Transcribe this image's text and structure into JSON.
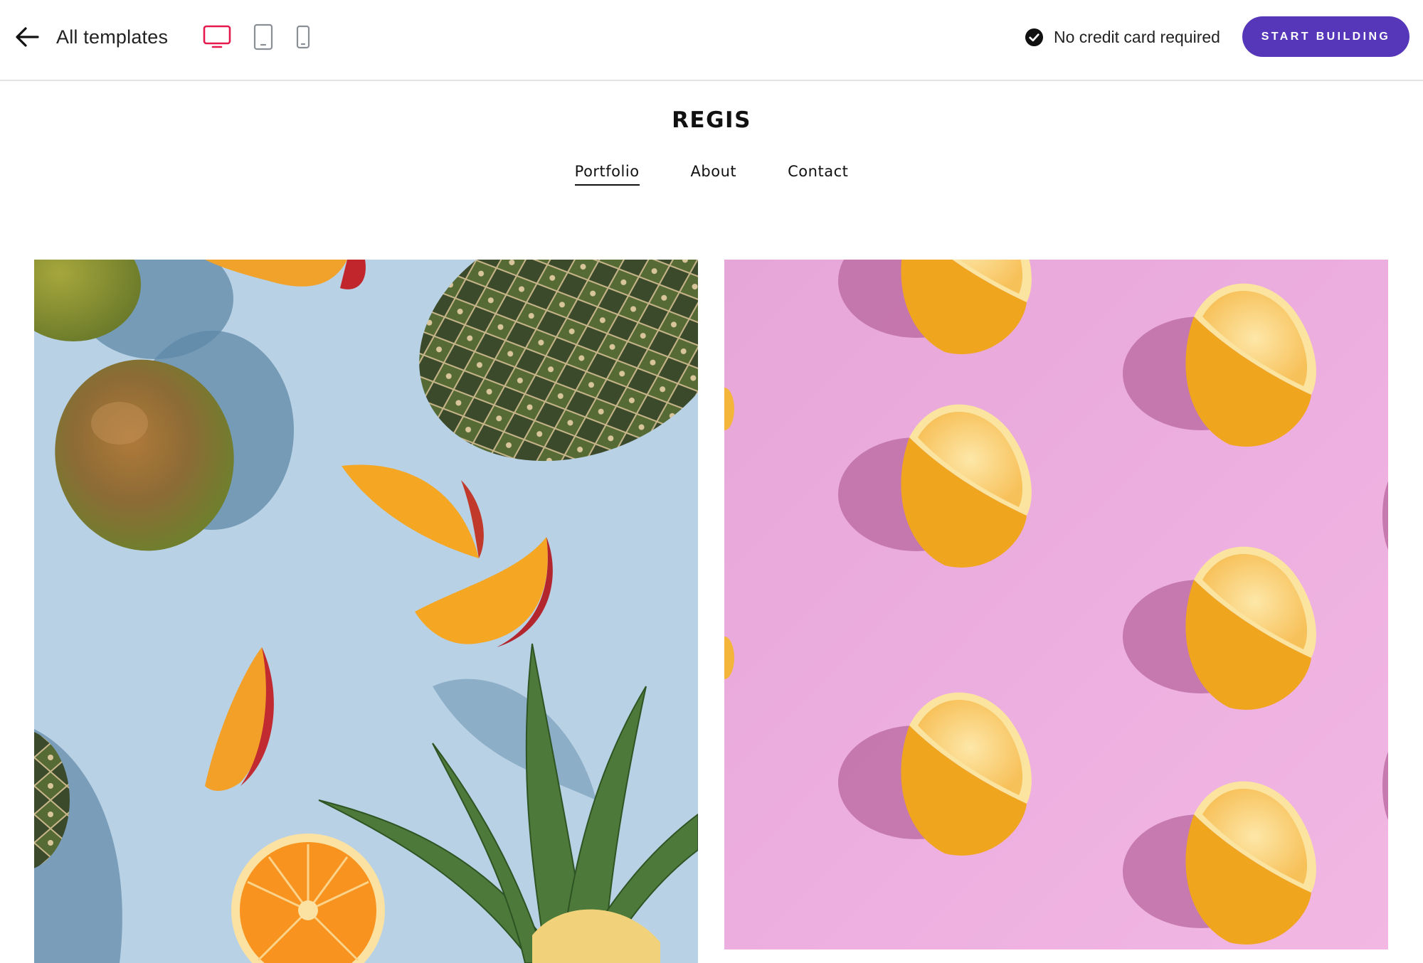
{
  "toolbar": {
    "back_label": "All templates",
    "devices": [
      {
        "name": "desktop",
        "active": true
      },
      {
        "name": "tablet",
        "active": false
      },
      {
        "name": "mobile",
        "active": false
      }
    ],
    "no_card_text": "No credit card required",
    "start_button_label": "START BUILDING",
    "accent_color": "#e5194e",
    "button_color": "#5637b9"
  },
  "site": {
    "title": "REGIS",
    "nav": [
      {
        "label": "Portfolio",
        "active": true
      },
      {
        "label": "About",
        "active": false
      },
      {
        "label": "Contact",
        "active": false
      }
    ]
  },
  "gallery": [
    {
      "subject": "tropical fruits on blue background",
      "background": "#b8d1e4"
    },
    {
      "subject": "lemon halves on pink background",
      "background": "#eaaadc"
    }
  ]
}
